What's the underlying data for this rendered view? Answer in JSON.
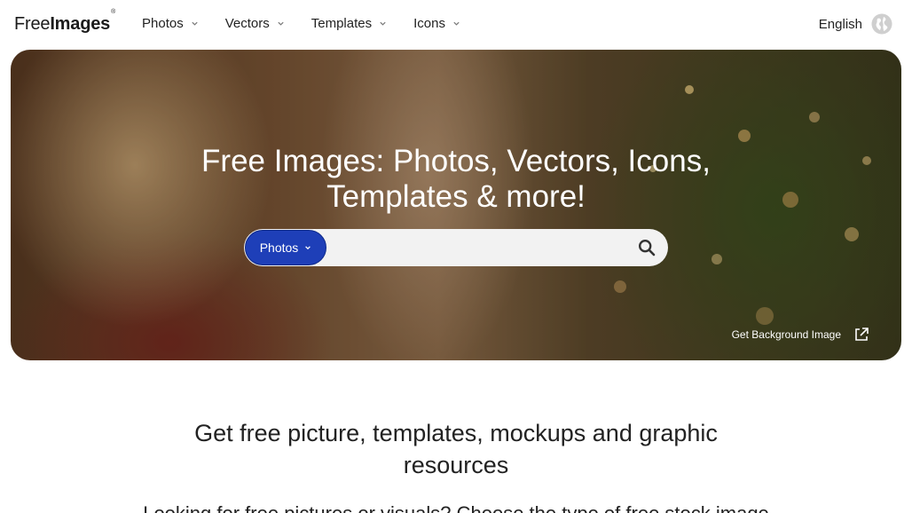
{
  "header": {
    "logo_text_light": "Free",
    "logo_text_bold": "Images",
    "logo_mark": "®",
    "nav": [
      {
        "label": "Photos"
      },
      {
        "label": "Vectors"
      },
      {
        "label": "Templates"
      },
      {
        "label": "Icons"
      }
    ],
    "language": "English"
  },
  "hero": {
    "title_line1": "Free Images: Photos, Vectors, Icons,",
    "title_line2": "Templates & more!",
    "search": {
      "type_label": "Photos",
      "value": "",
      "placeholder": ""
    },
    "get_background_label": "Get Background Image"
  },
  "main": {
    "subheading": "Get free picture, templates, mockups and graphic resources",
    "paragraph": "Looking for free pictures or visuals? Choose the type of free stock image"
  },
  "colors": {
    "accent": "#1e3fb8",
    "text": "#222222"
  },
  "icons": [
    "chevron-down-icon",
    "globe-icon",
    "search-icon",
    "external-link-icon"
  ]
}
